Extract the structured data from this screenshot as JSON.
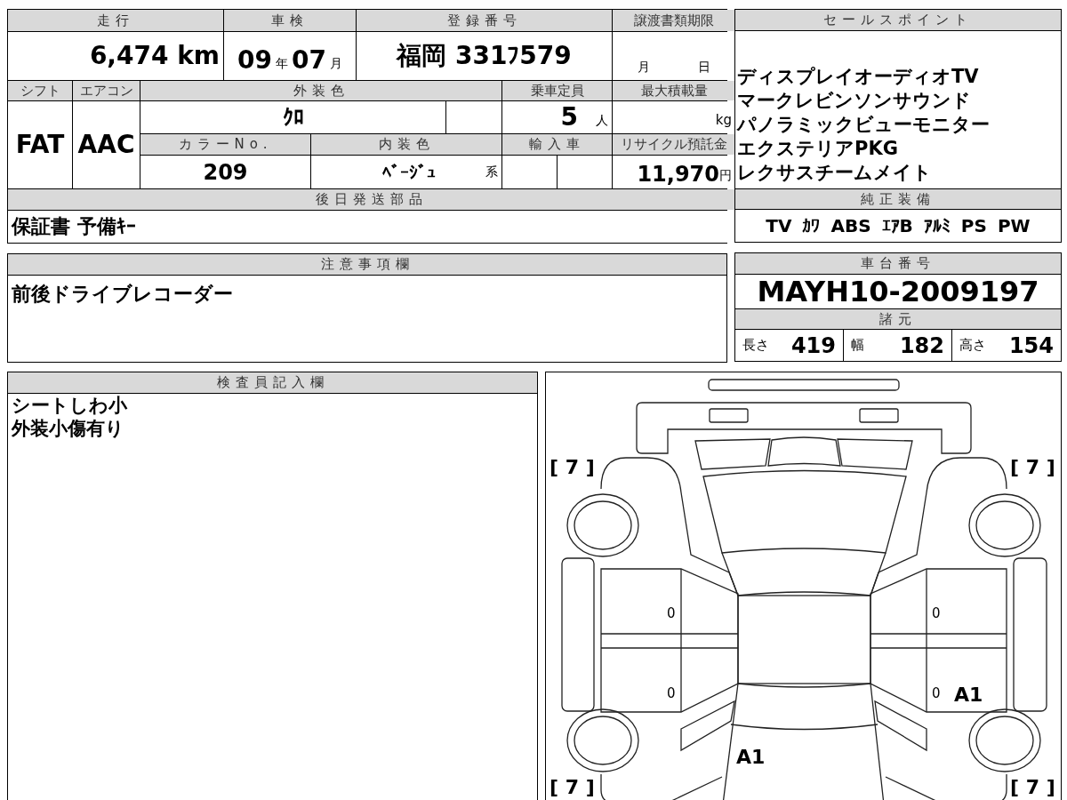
{
  "vehicle_table": {
    "mileage": {
      "header": "走行",
      "value": "6,474 km"
    },
    "inspection": {
      "header": "車検",
      "year": "09",
      "year_unit": "年",
      "month": "07",
      "month_unit": "月"
    },
    "registration": {
      "header": "登録番号",
      "value": "福岡 331ﾌ579"
    },
    "transfer_deadline": {
      "header": "譲渡書類期限",
      "month_unit": "月",
      "day_unit": "日"
    },
    "shift": {
      "header": "シフト",
      "value": "FAT"
    },
    "aircon": {
      "header": "エアコン",
      "value": "AAC"
    },
    "exterior_color": {
      "header": "外装色",
      "value": "ｸﾛ"
    },
    "capacity": {
      "header": "乗車定員",
      "value": "5",
      "unit": "人"
    },
    "max_load": {
      "header": "最大積載量",
      "unit": "kg"
    },
    "color_no": {
      "header": "カラーNo.",
      "value": "209"
    },
    "interior_color": {
      "header": "内装色",
      "value": "ﾍﾞｰｼﾞｭ",
      "suffix": "系"
    },
    "import": {
      "header": "輸入車"
    },
    "recycling_fee": {
      "header": "リサイクル預託金",
      "value": "11,970",
      "unit": "円"
    },
    "later_parts": {
      "header": "後日発送部品",
      "value": "保証書 予備ｷｰ"
    }
  },
  "sale_points": {
    "header": "セールスポイント",
    "lines": [
      "ディスプレイオーディオTV",
      "マークレビンソンサウンド",
      "パノラミックビューモニター",
      "エクステリアPKG",
      "レクサスチームメイト"
    ]
  },
  "equipment": {
    "header": "純正装備",
    "items": [
      "TV",
      "ｶﾜ",
      "ABS",
      "ｴｱB",
      "ｱﾙﾐ",
      "PS",
      "PW"
    ]
  },
  "notes": {
    "header": "注意事項欄",
    "text": "前後ドライブレコーダー"
  },
  "chassis": {
    "header": "車台番号",
    "value": "MAYH10-2009197"
  },
  "specs": {
    "header": "諸元",
    "items": [
      {
        "label": "長さ",
        "value": "419"
      },
      {
        "label": "幅",
        "value": "182"
      },
      {
        "label": "高さ",
        "value": "154"
      }
    ]
  },
  "inspector": {
    "header": "検査員記入欄",
    "lines": [
      "シートしわ小",
      "外装小傷有り"
    ]
  },
  "diagram": {
    "corner_labels": [
      "[ 7 ]",
      "[ 7 ]",
      "[ 7 ]",
      "[ 7 ]"
    ],
    "panel_marks": [
      "0",
      "0",
      "0",
      "0",
      "A1",
      "A1"
    ]
  }
}
